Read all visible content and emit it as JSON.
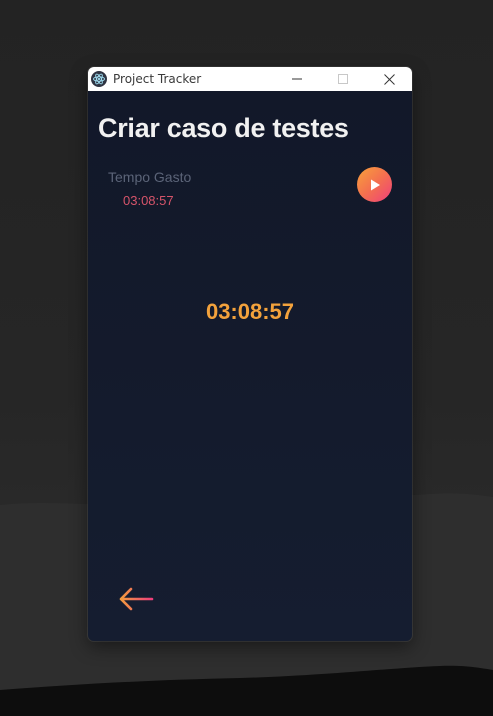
{
  "window": {
    "title": "Project Tracker",
    "app_icon": "electron-icon",
    "controls": [
      "minimize-icon",
      "maximize-icon",
      "close-icon"
    ]
  },
  "task": {
    "title": "Criar caso de testes",
    "time_spent_label": "Tempo Gasto",
    "time_spent_value": "03:08:57"
  },
  "timer": {
    "display": "03:08:57",
    "state": "paused",
    "action_icon": "play-icon"
  },
  "navigation": {
    "back_icon": "arrow-left-icon"
  },
  "colors": {
    "background": "#131a2b",
    "title_text": "#f1f1f1",
    "label_text": "#5b6478",
    "time_value": "#d6546a",
    "timer_text": "#f3a23c",
    "gradient_start": "#f7a23a",
    "gradient_end": "#ee3f7c"
  }
}
